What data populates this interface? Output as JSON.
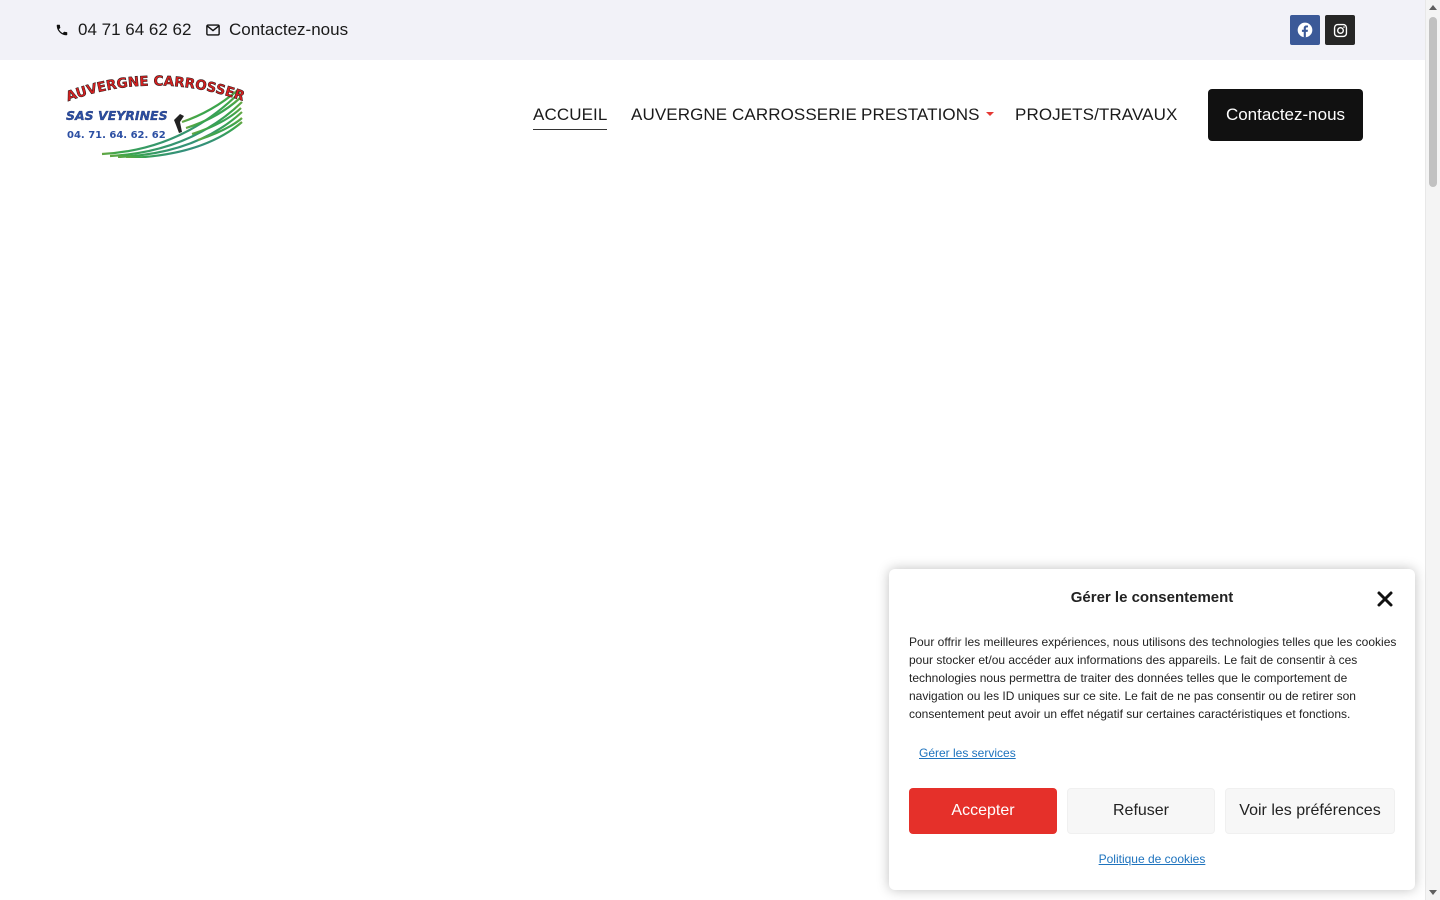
{
  "topbar": {
    "phone": "04 71 64 62 62",
    "contact_label": "Contactez-nous",
    "social": [
      {
        "icon": "facebook-icon",
        "color": "#3b5998"
      },
      {
        "icon": "instagram-icon",
        "color": "#262626"
      }
    ]
  },
  "logo": {
    "line1": "AUVERGNE CARROSSERIE",
    "line2": "SAS VEYRINES",
    "line3": "04. 71. 64. 62. 62"
  },
  "nav": {
    "items": [
      {
        "label": "ACCUEIL",
        "active": true
      },
      {
        "label": "AUVERGNE CARROSSERIE",
        "active": false
      },
      {
        "label": "PRESTATIONS",
        "active": false,
        "has_dropdown": true
      },
      {
        "label": "PROJETS/TRAVAUX",
        "active": false
      }
    ],
    "cta_label": "Contactez-nous"
  },
  "consent": {
    "title": "Gérer le consentement",
    "body": "Pour offrir les meilleures expériences, nous utilisons des technologies telles que les cookies pour stocker et/ou accéder aux informations des appareils. Le fait de consentir à ces technologies nous permettra de traiter des données telles que le comportement de navigation ou les ID uniques sur ce site. Le fait de ne pas consentir ou de retirer son consentement peut avoir un effet négatif sur certaines caractéristiques et fonctions.",
    "manage_services": "Gérer les services",
    "accept_label": "Accepter",
    "refuse_label": "Refuser",
    "preferences_label": "Voir les préférences",
    "policy_link": "Politique de cookies"
  },
  "colors": {
    "accent_red": "#e5302a",
    "link_blue": "#1e73be",
    "topbar_bg": "#f2f2f8",
    "cta_bg": "#111111"
  }
}
